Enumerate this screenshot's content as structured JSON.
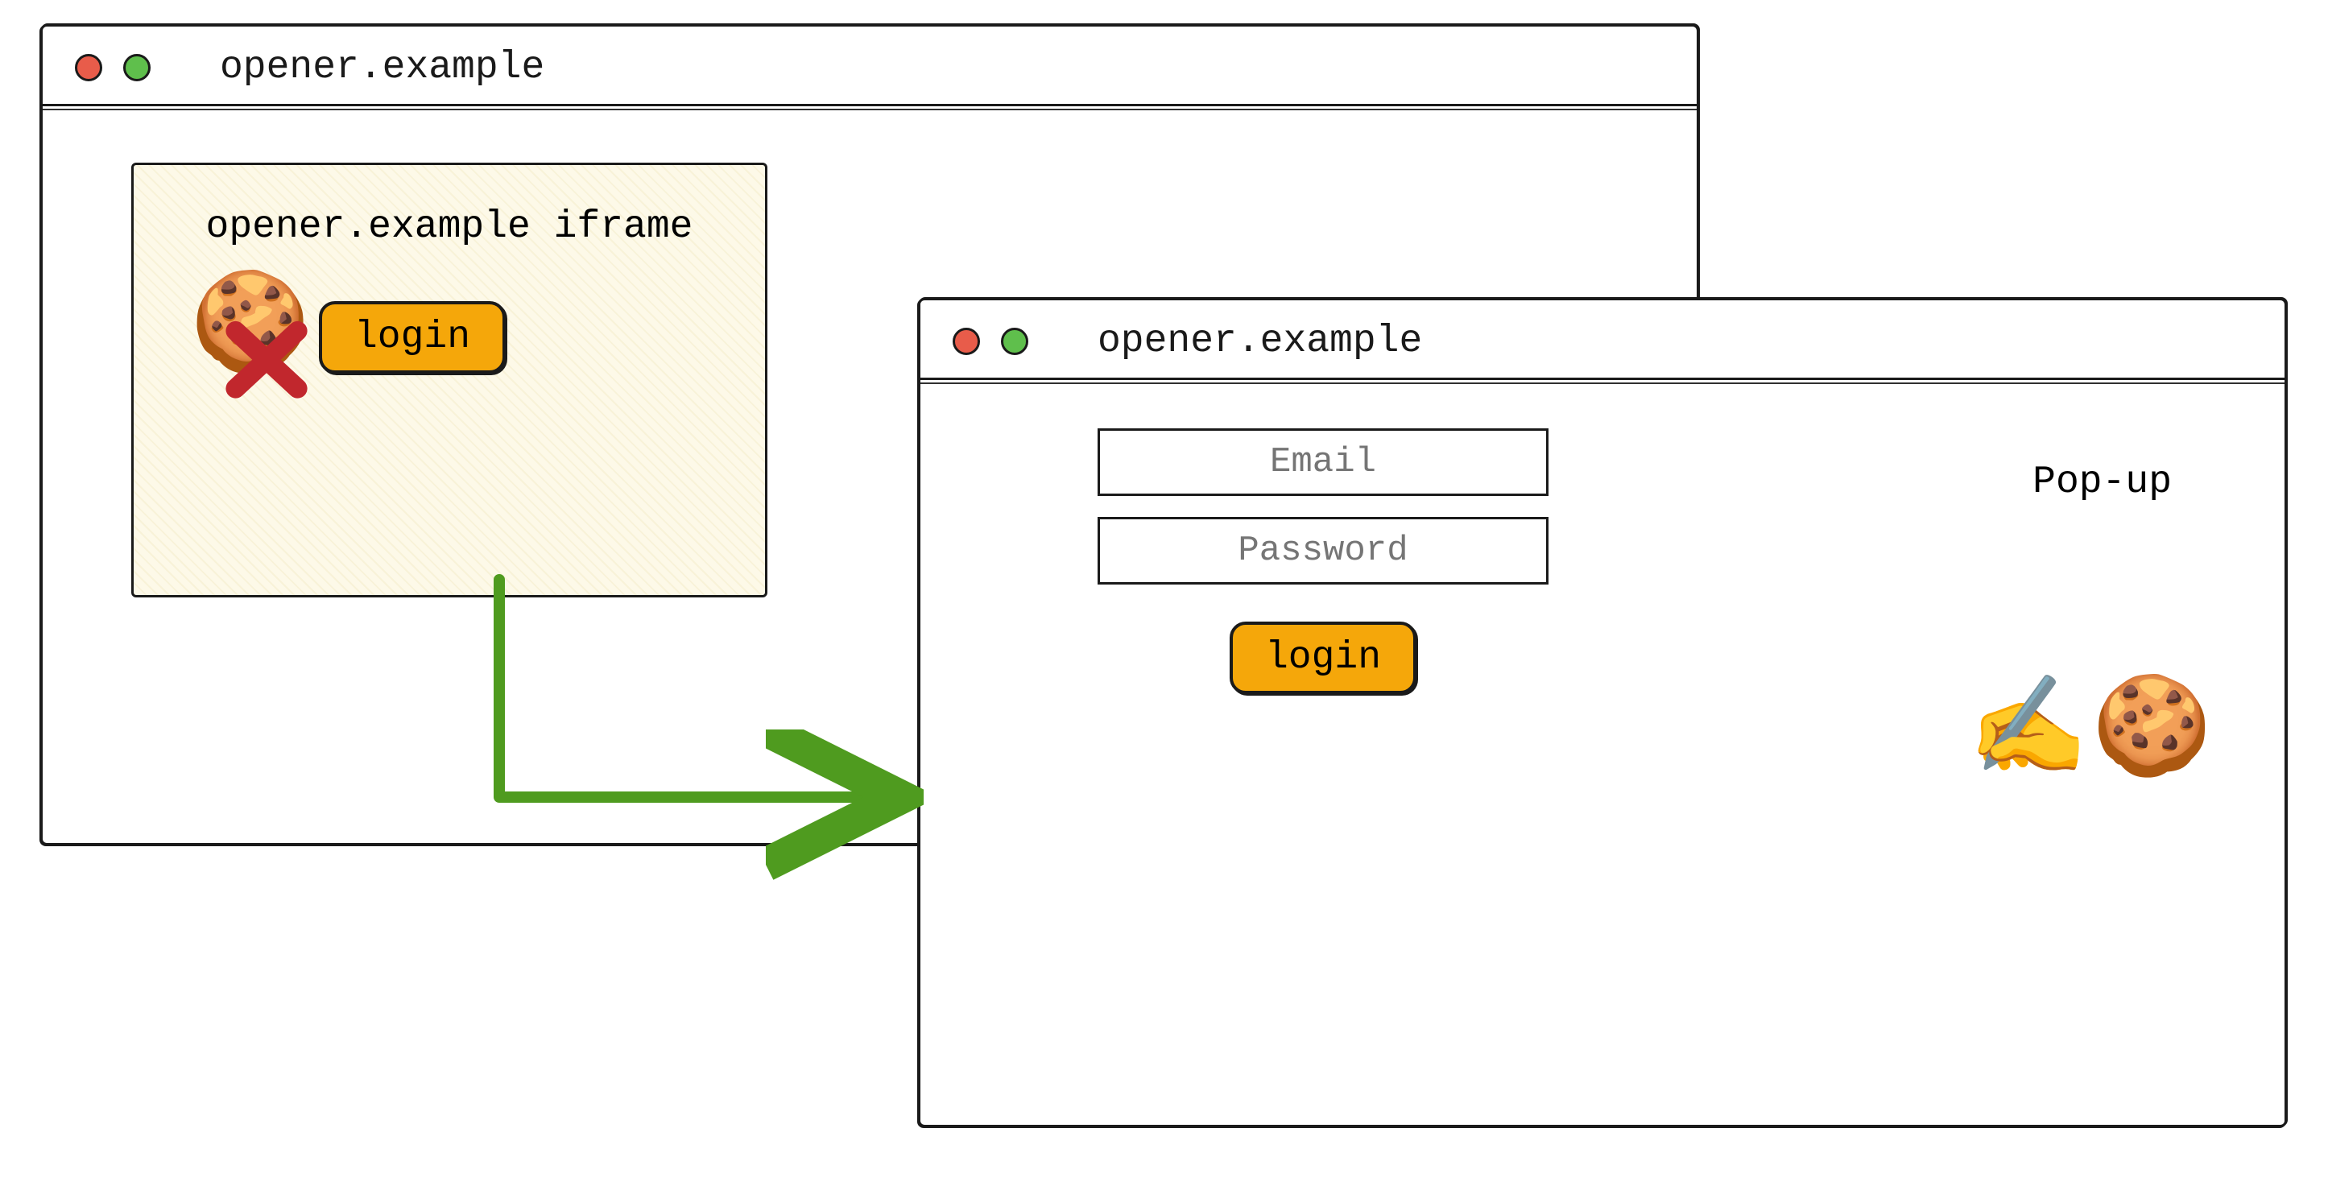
{
  "windowA": {
    "title": "opener.example",
    "iframe": {
      "label": "opener.example iframe",
      "login_button": "login",
      "cookie_icon": "🍪",
      "cookie_status": "blocked"
    }
  },
  "windowB": {
    "title": "opener.example",
    "popup_label": "Pop-up",
    "email_placeholder": "Email",
    "password_placeholder": "Password",
    "login_button": "login",
    "write_icon": "✍️",
    "cookie_icon": "🍪"
  },
  "arrow": {
    "color": "#4f9b1f"
  }
}
